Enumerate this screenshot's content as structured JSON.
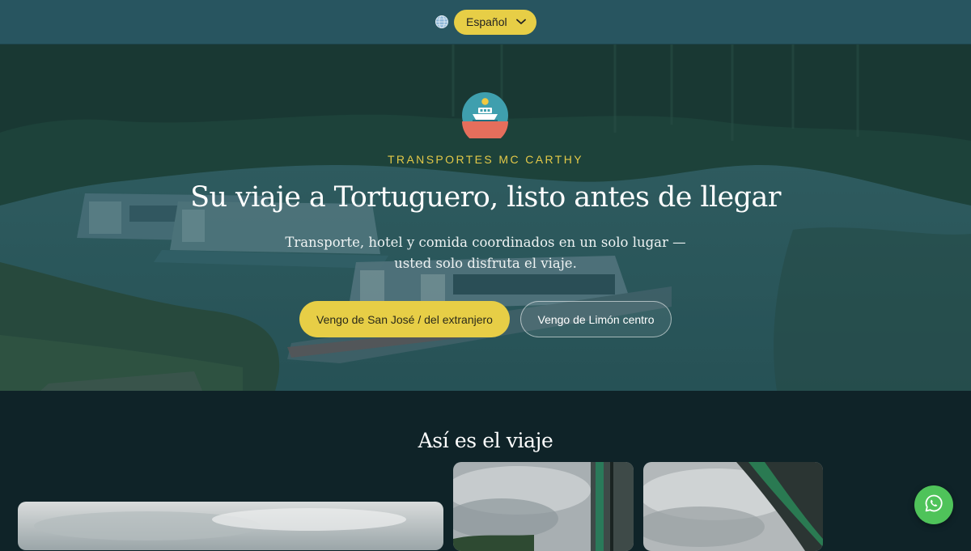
{
  "header": {
    "globe_icon": "globe-icon",
    "language": {
      "selected": "Español",
      "icon": "chevron-down-icon"
    }
  },
  "hero": {
    "logo_icon": "boat-sun-logo",
    "brand": "TRANSPORTES MC CARTHY",
    "headline": "Su viaje a Tortuguero, listo antes de llegar",
    "subtitle": "Transporte, hotel y comida coordinados en un solo lugar — usted solo disfruta el viaje.",
    "buttons": {
      "primary": "Vengo de San José / del extranjero",
      "secondary": "Vengo de Limón centro"
    }
  },
  "gallery": {
    "title": "Así es el viaje"
  },
  "floating": {
    "whatsapp_icon": "whatsapp-icon"
  },
  "colors": {
    "accent_yellow": "#e7ce46",
    "header_teal": "#285560",
    "page_dark": "#0f2328",
    "whatsapp_green": "#4fc35a"
  }
}
